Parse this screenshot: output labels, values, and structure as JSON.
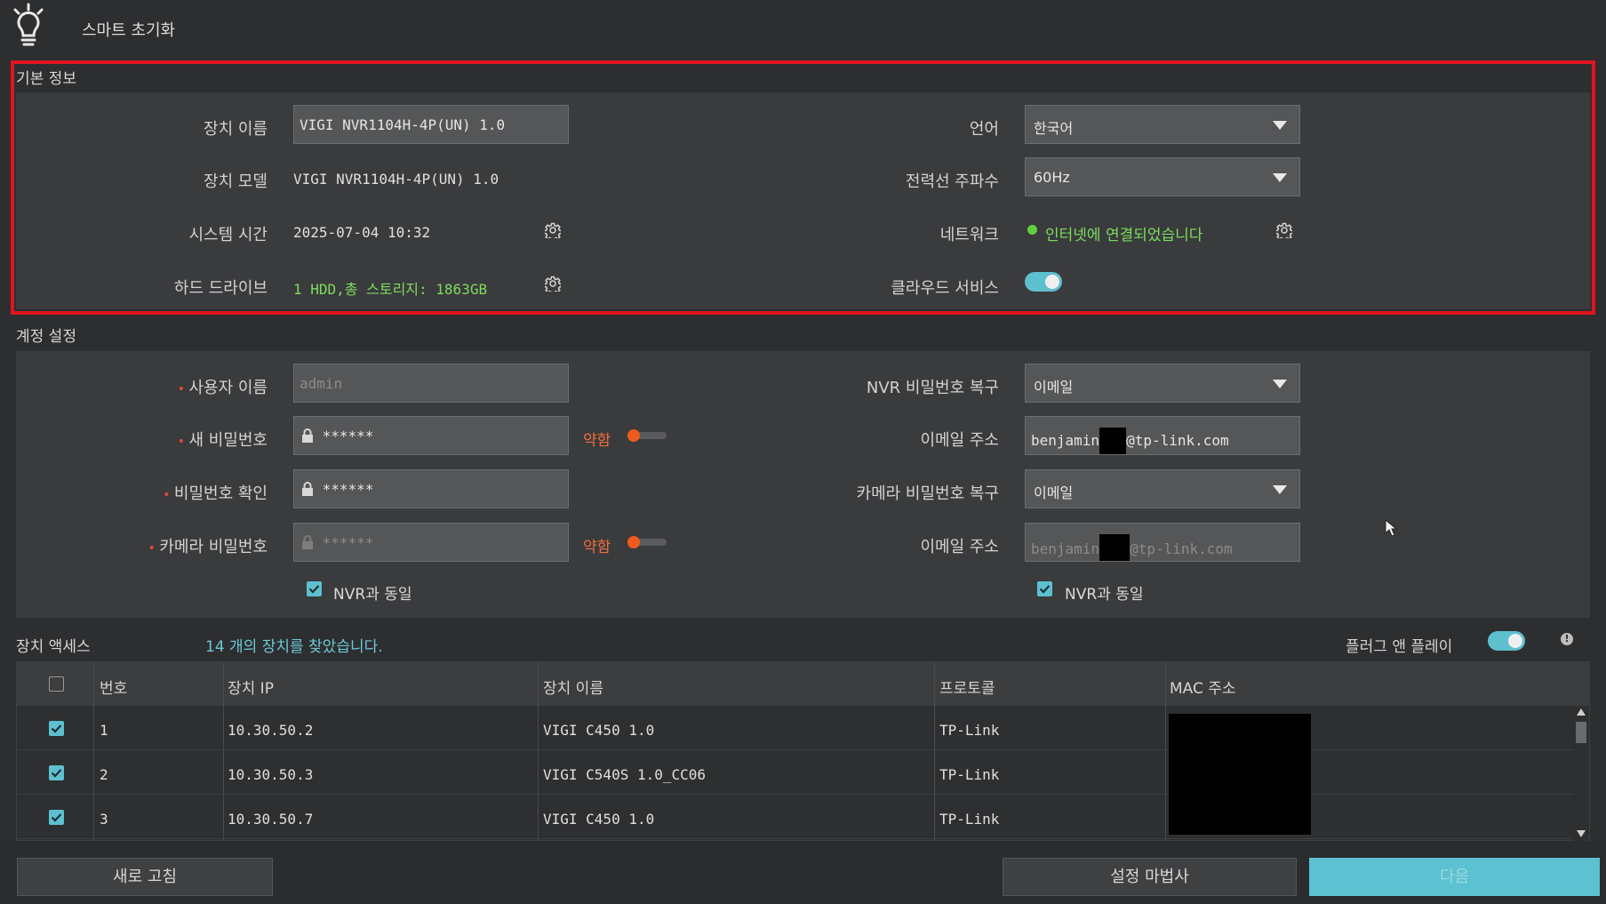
{
  "header": {
    "title": "스마트 초기화"
  },
  "basic": {
    "title": "기본 정보",
    "device_name_label": "장치 이름",
    "device_name_value": "VIGI NVR1104H-4P(UN) 1.0",
    "device_model_label": "장치 모델",
    "device_model_value": "VIGI NVR1104H-4P(UN) 1.0",
    "system_time_label": "시스템 시간",
    "system_time_value": "2025-07-04 10:32",
    "hdd_label": "하드 드라이브",
    "hdd_value": "1 HDD,총 스토리지: 1863GB",
    "language_label": "언어",
    "language_value": "한국어",
    "power_freq_label": "전력선 주파수",
    "power_freq_value": "60Hz",
    "network_label": "네트워크",
    "network_value": "인터넷에 연결되었습니다",
    "cloud_label": "클라우드 서비스",
    "cloud_enabled": true
  },
  "account": {
    "title": "계정 설정",
    "username_label": "사용자 이름",
    "username_placeholder": "admin",
    "new_password_label": "새 비밀번호",
    "new_password_value": "******",
    "confirm_password_label": "비밀번호 확인",
    "confirm_password_value": "******",
    "camera_password_label": "카메라 비밀번호",
    "camera_password_value": "******",
    "strength_label": "약함",
    "same_as_nvr_label": "NVR과 동일",
    "nvr_recovery_label": "NVR 비밀번호 복구",
    "nvr_recovery_value": "이메일",
    "email_label": "이메일 주소",
    "email_prefix": "benjamin",
    "email_suffix": "@tp-link.com",
    "camera_recovery_label": "카메라 비밀번호 복구",
    "camera_recovery_value": "이메일",
    "camera_email_label": "이메일 주소",
    "camera_same_as_nvr_label": "NVR과 동일"
  },
  "access": {
    "title": "장치 액세스",
    "found_text": "14 개의 장치를 찾았습니다.",
    "plug_play_label": "플러그 앤 플레이",
    "plug_play_enabled": true,
    "columns": [
      "번호",
      "장치 IP",
      "장치 이름",
      "프로토콜",
      "MAC 주소"
    ],
    "rows": [
      {
        "no": "1",
        "ip": "10.30.50.2",
        "name": "VIGI C450 1.0",
        "protocol": "TP-Link"
      },
      {
        "no": "2",
        "ip": "10.30.50.3",
        "name": "VIGI C540S 1.0_CC06",
        "protocol": "TP-Link"
      },
      {
        "no": "3",
        "ip": "10.30.50.7",
        "name": "VIGI C450 1.0",
        "protocol": "TP-Link"
      }
    ]
  },
  "footer": {
    "refresh_label": "새로 고침",
    "wizard_label": "설정 마법사",
    "next_label": "다음"
  },
  "colors": {
    "accent": "#5cc1d0",
    "highlight_border": "#e0141e",
    "ok_green": "#7ddc5d",
    "weak_orange": "#ef6d3c"
  }
}
